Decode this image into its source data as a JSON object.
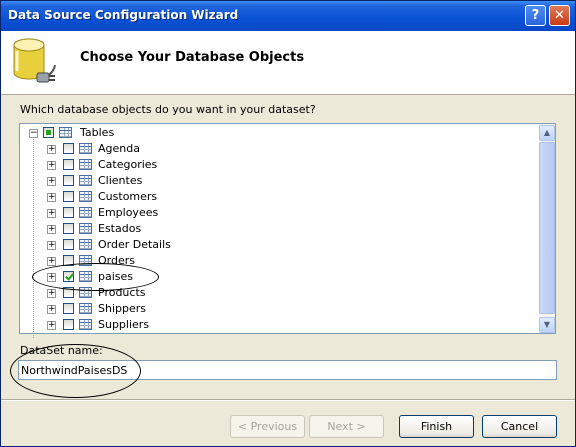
{
  "window": {
    "title": "Data Source Configuration Wizard",
    "help_label": "?",
    "close_label": "✕"
  },
  "header": {
    "title": "Choose Your Database Objects",
    "icon": "database-connect-icon"
  },
  "prompt": "Which database objects do you want in your dataset?",
  "tree": {
    "root": {
      "label": "Tables",
      "state": "partial",
      "expander": "⊟"
    },
    "items": [
      {
        "label": "Agenda",
        "checked": false
      },
      {
        "label": "Categories",
        "checked": false
      },
      {
        "label": "Clientes",
        "checked": false
      },
      {
        "label": "Customers",
        "checked": false
      },
      {
        "label": "Employees",
        "checked": false
      },
      {
        "label": "Estados",
        "checked": false
      },
      {
        "label": "Order Details",
        "checked": false
      },
      {
        "label": "Orders",
        "checked": false
      },
      {
        "label": "paises",
        "checked": true
      },
      {
        "label": "Products",
        "checked": false
      },
      {
        "label": "Shippers",
        "checked": false
      },
      {
        "label": "Suppliers",
        "checked": false
      }
    ],
    "item_expander": "+"
  },
  "scrollbar": {
    "up": "▲",
    "down": "▼"
  },
  "dataset": {
    "label": "DataSet name:",
    "value": "NorthwindPaisesDS"
  },
  "buttons": {
    "previous": "< Previous",
    "next": "Next >",
    "finish": "Finish",
    "cancel": "Cancel"
  },
  "colors": {
    "titlebar": "#0a52d6",
    "face": "#ece9d8",
    "check": "#21a121"
  }
}
